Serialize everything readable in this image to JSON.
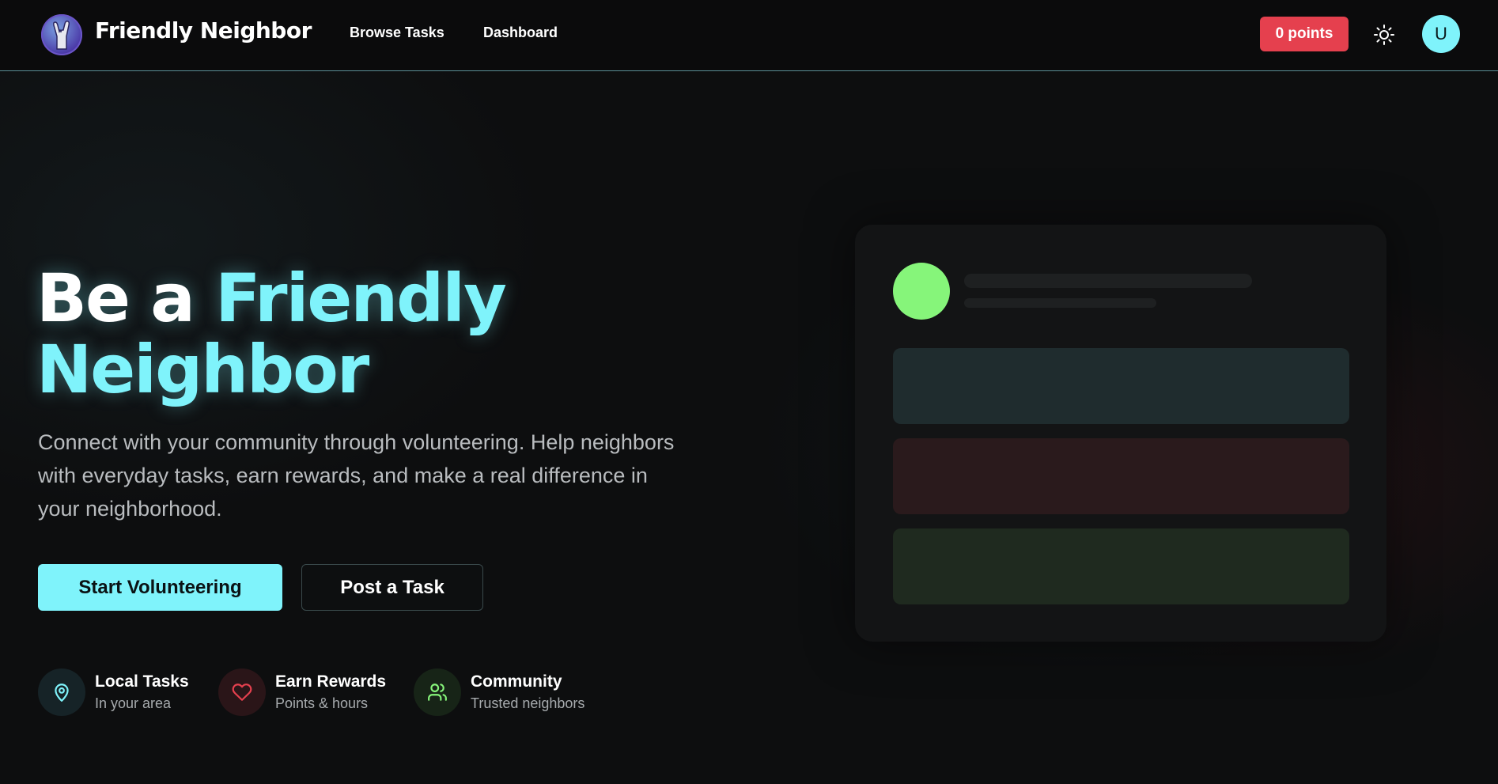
{
  "header": {
    "brand": "Friendly Neighbor",
    "nav": {
      "browse_tasks": "Browse Tasks",
      "dashboard": "Dashboard"
    },
    "points_label": "0 points",
    "avatar_initial": "U",
    "icons": {
      "logo": "rock-hand-logo-icon",
      "theme_toggle": "sun-icon"
    }
  },
  "hero": {
    "title_part1": "Be a ",
    "title_accent": "Friendly Neighbor",
    "subtitle": "Connect with your community through volunteering. Help neighbors with everyday tasks, earn rewards, and make a real difference in your neighborhood.",
    "primary_button": "Start Volunteering",
    "secondary_button": "Post a Task"
  },
  "features": [
    {
      "title": "Local Tasks",
      "subtitle": "In your area",
      "icon": "map-pin-icon",
      "color": "#7ff3fb"
    },
    {
      "title": "Earn Rewards",
      "subtitle": "Points & hours",
      "icon": "heart-icon",
      "color": "#e5404e"
    },
    {
      "title": "Community",
      "subtitle": "Trusted neighbors",
      "icon": "users-icon",
      "color": "#86f57a"
    }
  ],
  "colors": {
    "accent_cyan": "#7ff3fb",
    "accent_red": "#e5404e",
    "accent_green": "#86f57a",
    "background": "#0d0e0f"
  }
}
